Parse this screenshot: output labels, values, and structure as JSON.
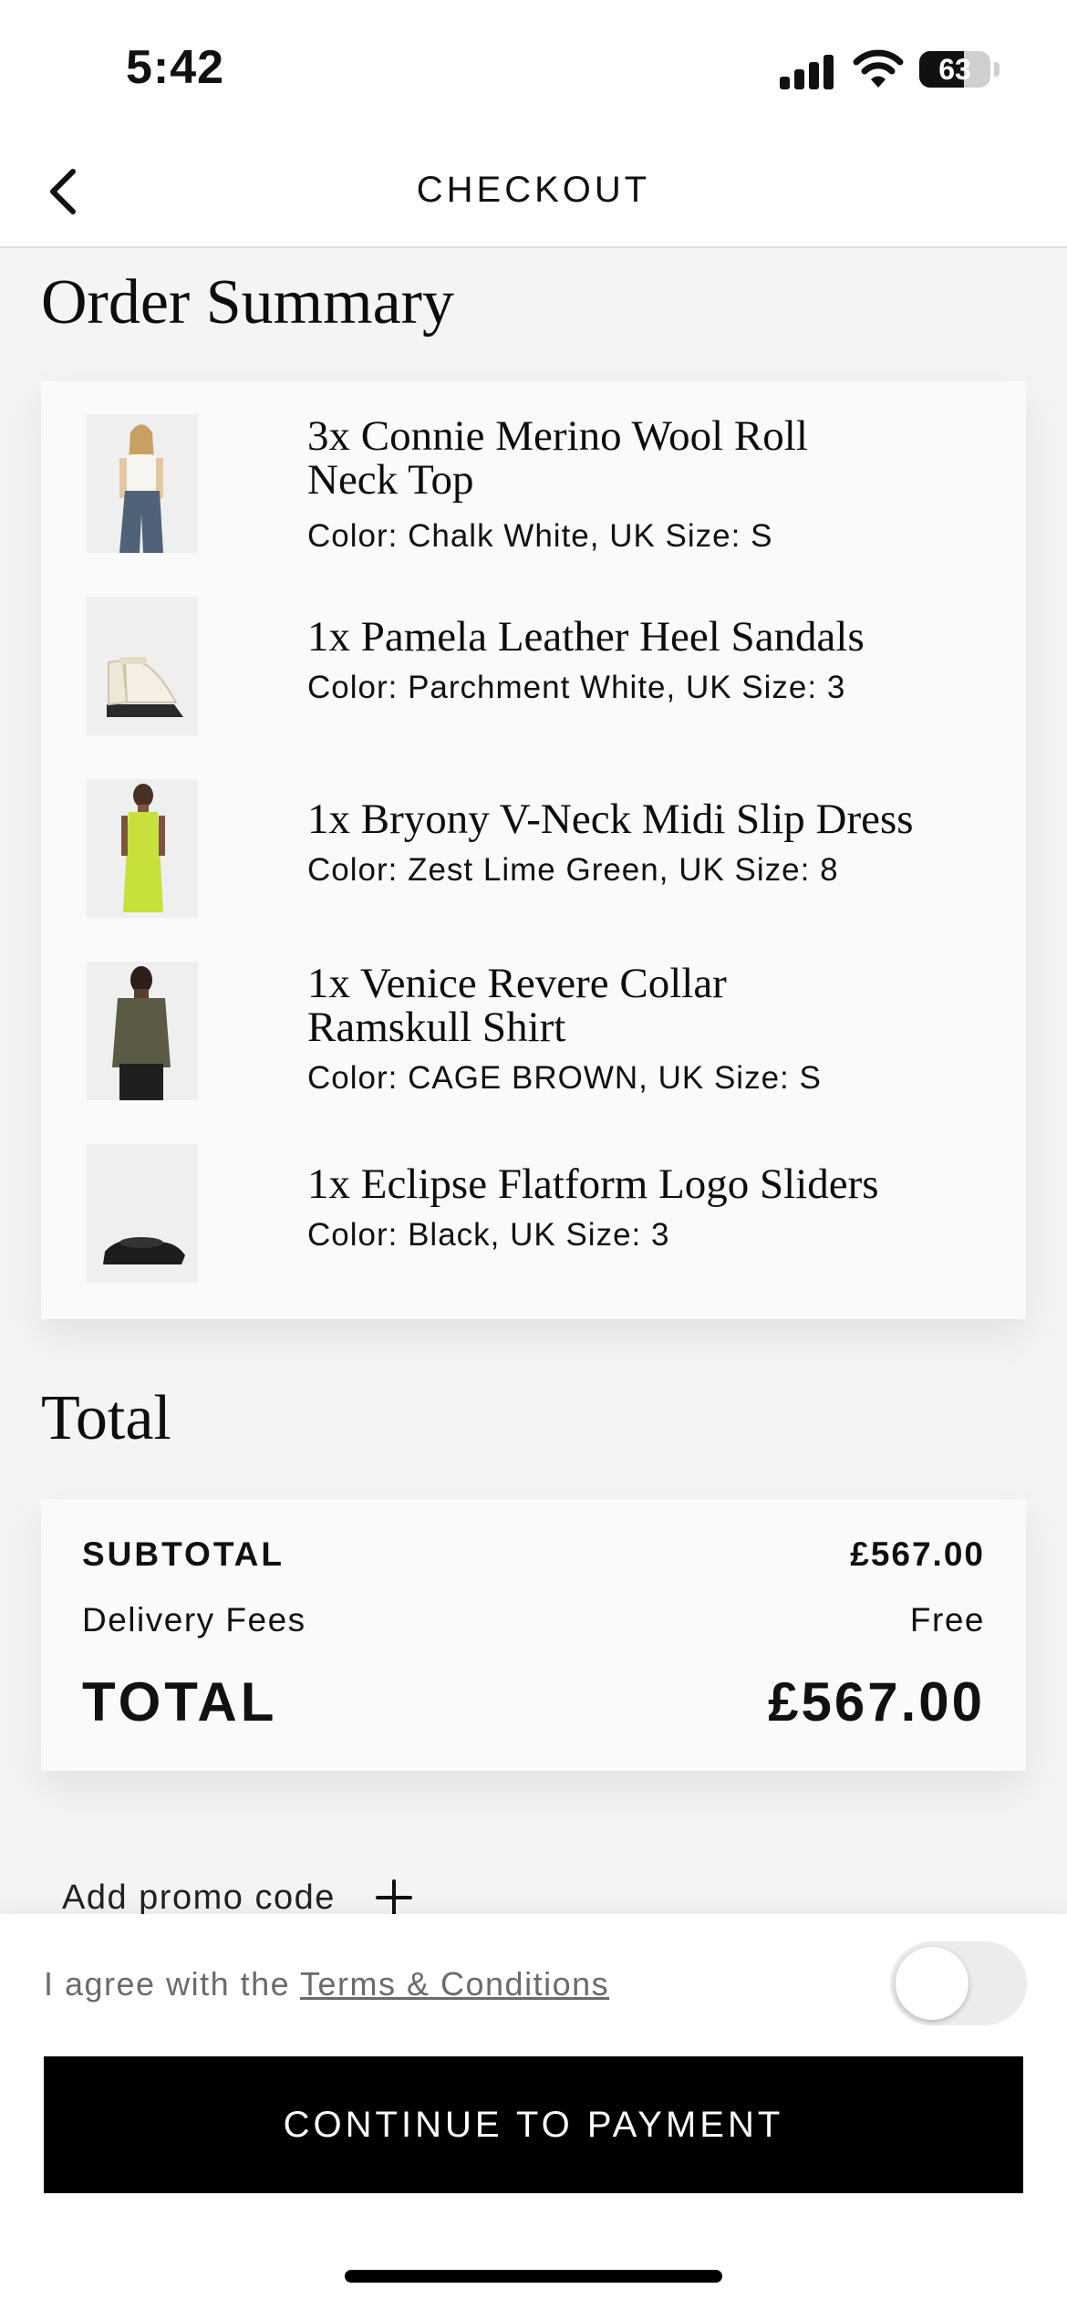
{
  "status_bar": {
    "time": "5:42",
    "battery": "63",
    "battery_level": 0.63
  },
  "header": {
    "title": "CHECKOUT",
    "back_icon": "chevron-left-icon"
  },
  "order_summary": {
    "title": "Order Summary",
    "items": [
      {
        "name_line1": "3x Connie Merino Wool Roll",
        "name_line2": "Neck Top",
        "meta": "Color: Chalk White, UK Size: S",
        "thumb": "white-top-model"
      },
      {
        "name_line1": "1x Pamela Leather Heel Sandals",
        "name_line2": "",
        "meta": "Color: Parchment White, UK Size: 3",
        "thumb": "white-heel-sandal"
      },
      {
        "name_line1": "1x Bryony V-Neck Midi Slip Dress",
        "name_line2": "",
        "meta": "Color: Zest Lime Green, UK Size: 8",
        "thumb": "lime-dress-model"
      },
      {
        "name_line1": "1x Venice Revere Collar",
        "name_line2": "Ramskull Shirt",
        "meta": "Color: CAGE BROWN, UK Size: S",
        "thumb": "brown-shirt-model"
      },
      {
        "name_line1": "1x Eclipse Flatform Logo Sliders",
        "name_line2": "",
        "meta": "Color: Black, UK Size: 3",
        "thumb": "black-slider"
      }
    ]
  },
  "total": {
    "title": "Total",
    "subtotal_label": "SUBTOTAL",
    "subtotal_value": "£567.00",
    "delivery_label": "Delivery Fees",
    "delivery_value": "Free",
    "total_label": "TOTAL",
    "total_value": "£567.00"
  },
  "promo": {
    "label": "Add promo code",
    "icon": "plus-icon"
  },
  "agreement": {
    "prefix": "I agree with the ",
    "link": "Terms & Conditions",
    "toggle_on": false
  },
  "cta": {
    "label": "CONTINUE TO PAYMENT"
  },
  "colors": {
    "primary": "#000000",
    "background": "#f4f4f4",
    "card": "#fafafa",
    "muted_text": "#6b6b6b"
  }
}
